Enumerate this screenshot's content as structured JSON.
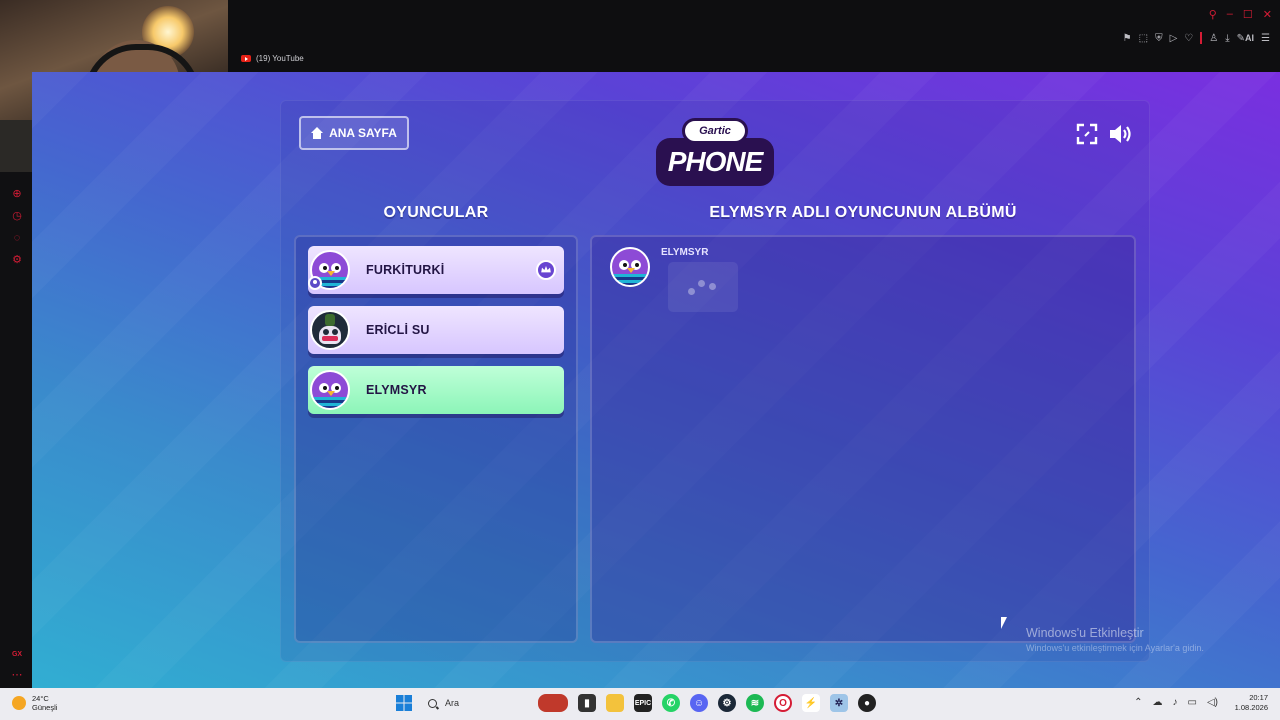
{
  "browser": {
    "tab_title": "(19) YouTube",
    "toolbar_ai_label": "AI"
  },
  "game": {
    "logo_top": "Gartic",
    "logo_main": "PHONE",
    "home_button_label": "ANA SAYFA",
    "players_title": "OYUNCULAR",
    "album_title": "ELYMSYR ADLI OYUNCUNUN ALBÜMÜ",
    "players": [
      {
        "name": "FURKİTURKİ",
        "avatar": "bird-avatar",
        "owner": true,
        "crown": true,
        "highlighted": false
      },
      {
        "name": "ERİCLİ SU",
        "avatar": "skull-avatar",
        "owner": false,
        "crown": false,
        "highlighted": false
      },
      {
        "name": "ELYMSYR",
        "avatar": "bird-avatar",
        "owner": false,
        "crown": false,
        "highlighted": true
      }
    ],
    "album": {
      "player_name": "ELYMSYR",
      "status": "loading"
    },
    "colors": {
      "background_top": "#7a2fe0",
      "background_bottom": "#31aed2",
      "row_default": "#e4d7ff",
      "row_highlight": "#a6f7c6"
    }
  },
  "os": {
    "watermark_title": "Windows'u Etkinleştir",
    "watermark_sub": "Windows'u etkinleştirmek için Ayarlar'a gidin.",
    "weather_temp": "24°C",
    "weather_desc": "Güneşli",
    "search_placeholder": "Ara",
    "clock_time": "20:17",
    "clock_date": "1.08.2026",
    "sidebar_label": "GX"
  }
}
